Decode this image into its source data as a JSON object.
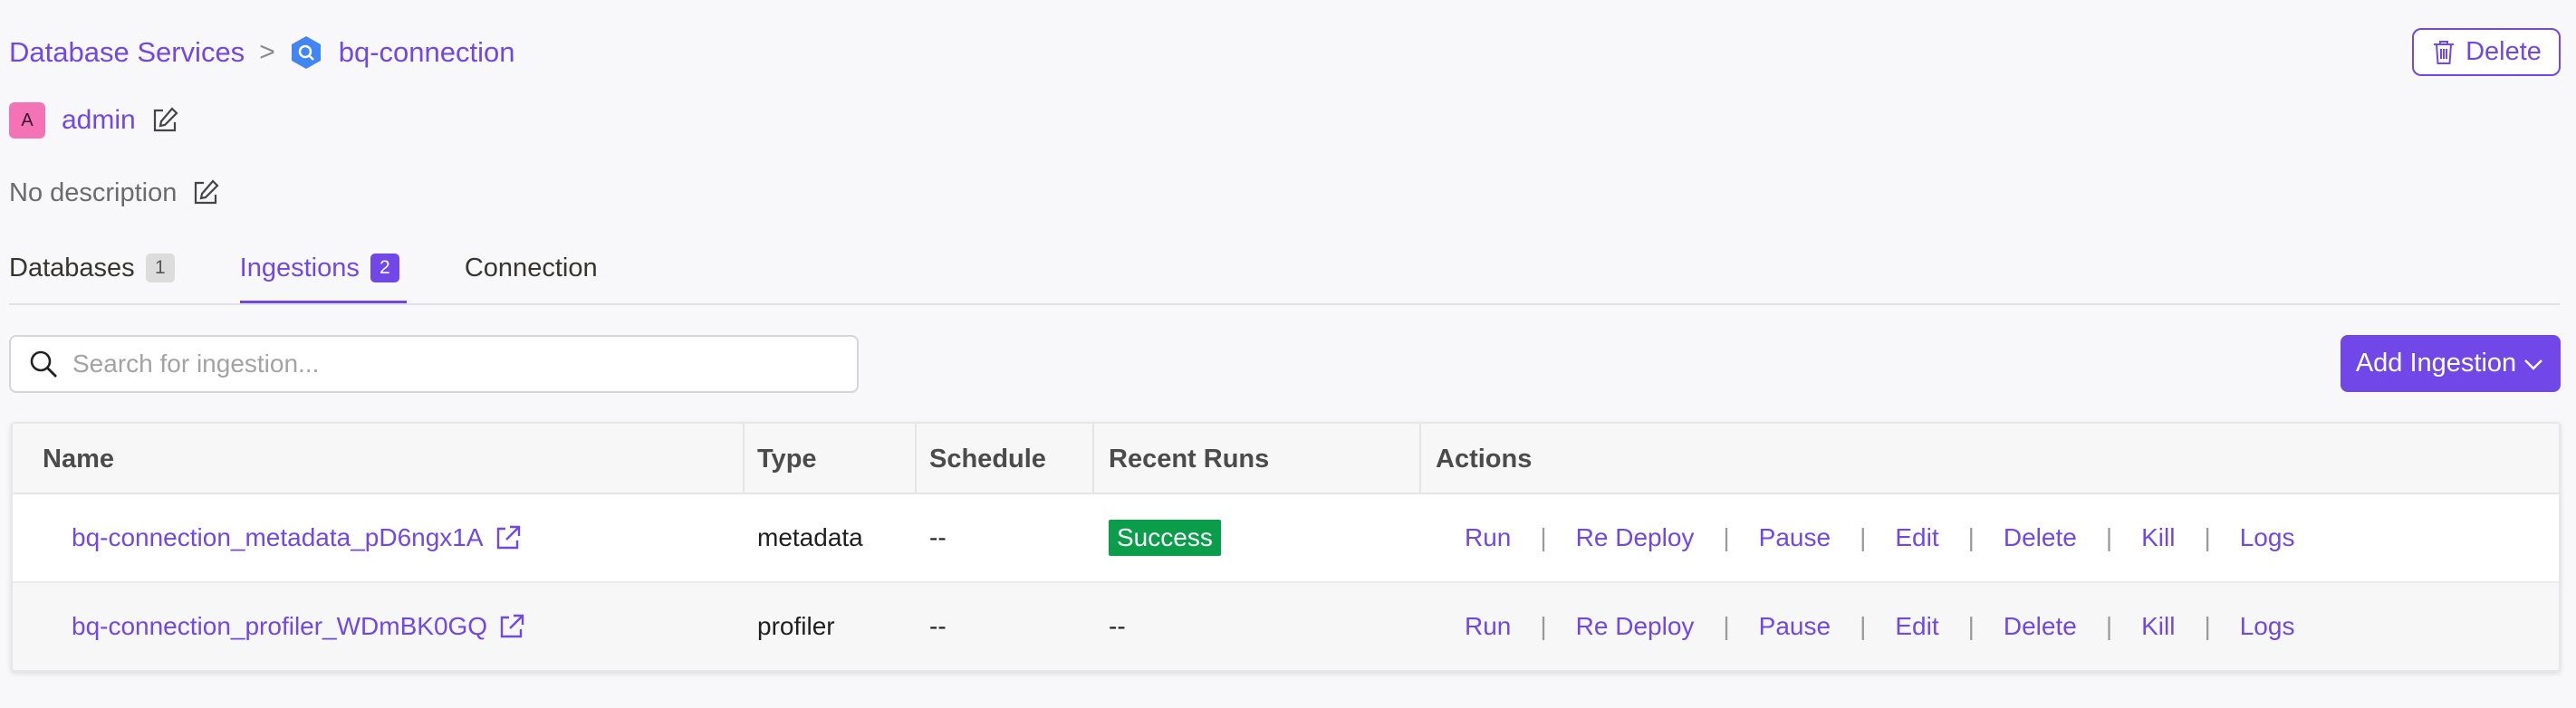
{
  "breadcrumb": {
    "parent": "Database Services",
    "separator": ">",
    "current": "bq-connection"
  },
  "header": {
    "delete_label": "Delete"
  },
  "owner": {
    "initial": "A",
    "name": "admin"
  },
  "description": {
    "text": "No description"
  },
  "tabs": [
    {
      "label": "Databases",
      "count": "1"
    },
    {
      "label": "Ingestions",
      "count": "2",
      "active": true
    },
    {
      "label": "Connection"
    }
  ],
  "search": {
    "placeholder": "Search for ingestion...",
    "value": ""
  },
  "add_button": {
    "label": "Add Ingestion"
  },
  "table": {
    "headers": [
      "Name",
      "Type",
      "Schedule",
      "Recent Runs",
      "Actions"
    ],
    "rows": [
      {
        "name": "bq-connection_metadata_pD6ngx1A",
        "type": "metadata",
        "schedule": "--",
        "recent_runs": "Success"
      },
      {
        "name": "bq-connection_profiler_WDmBK0GQ",
        "type": "profiler",
        "schedule": "--",
        "recent_runs": "--"
      }
    ],
    "actions": [
      "Run",
      "Re Deploy",
      "Pause",
      "Edit",
      "Delete",
      "Kill",
      "Logs"
    ],
    "action_separator": "|"
  },
  "colors": {
    "accent": "#7147e8",
    "success": "#0a9d4a",
    "avatar": "#f472b6",
    "service_icon": "#4285f4"
  },
  "icons": [
    "chevron-right-icon",
    "bigquery-icon",
    "trash-icon",
    "edit-icon",
    "search-icon",
    "chevron-down-icon",
    "external-link-icon"
  ]
}
